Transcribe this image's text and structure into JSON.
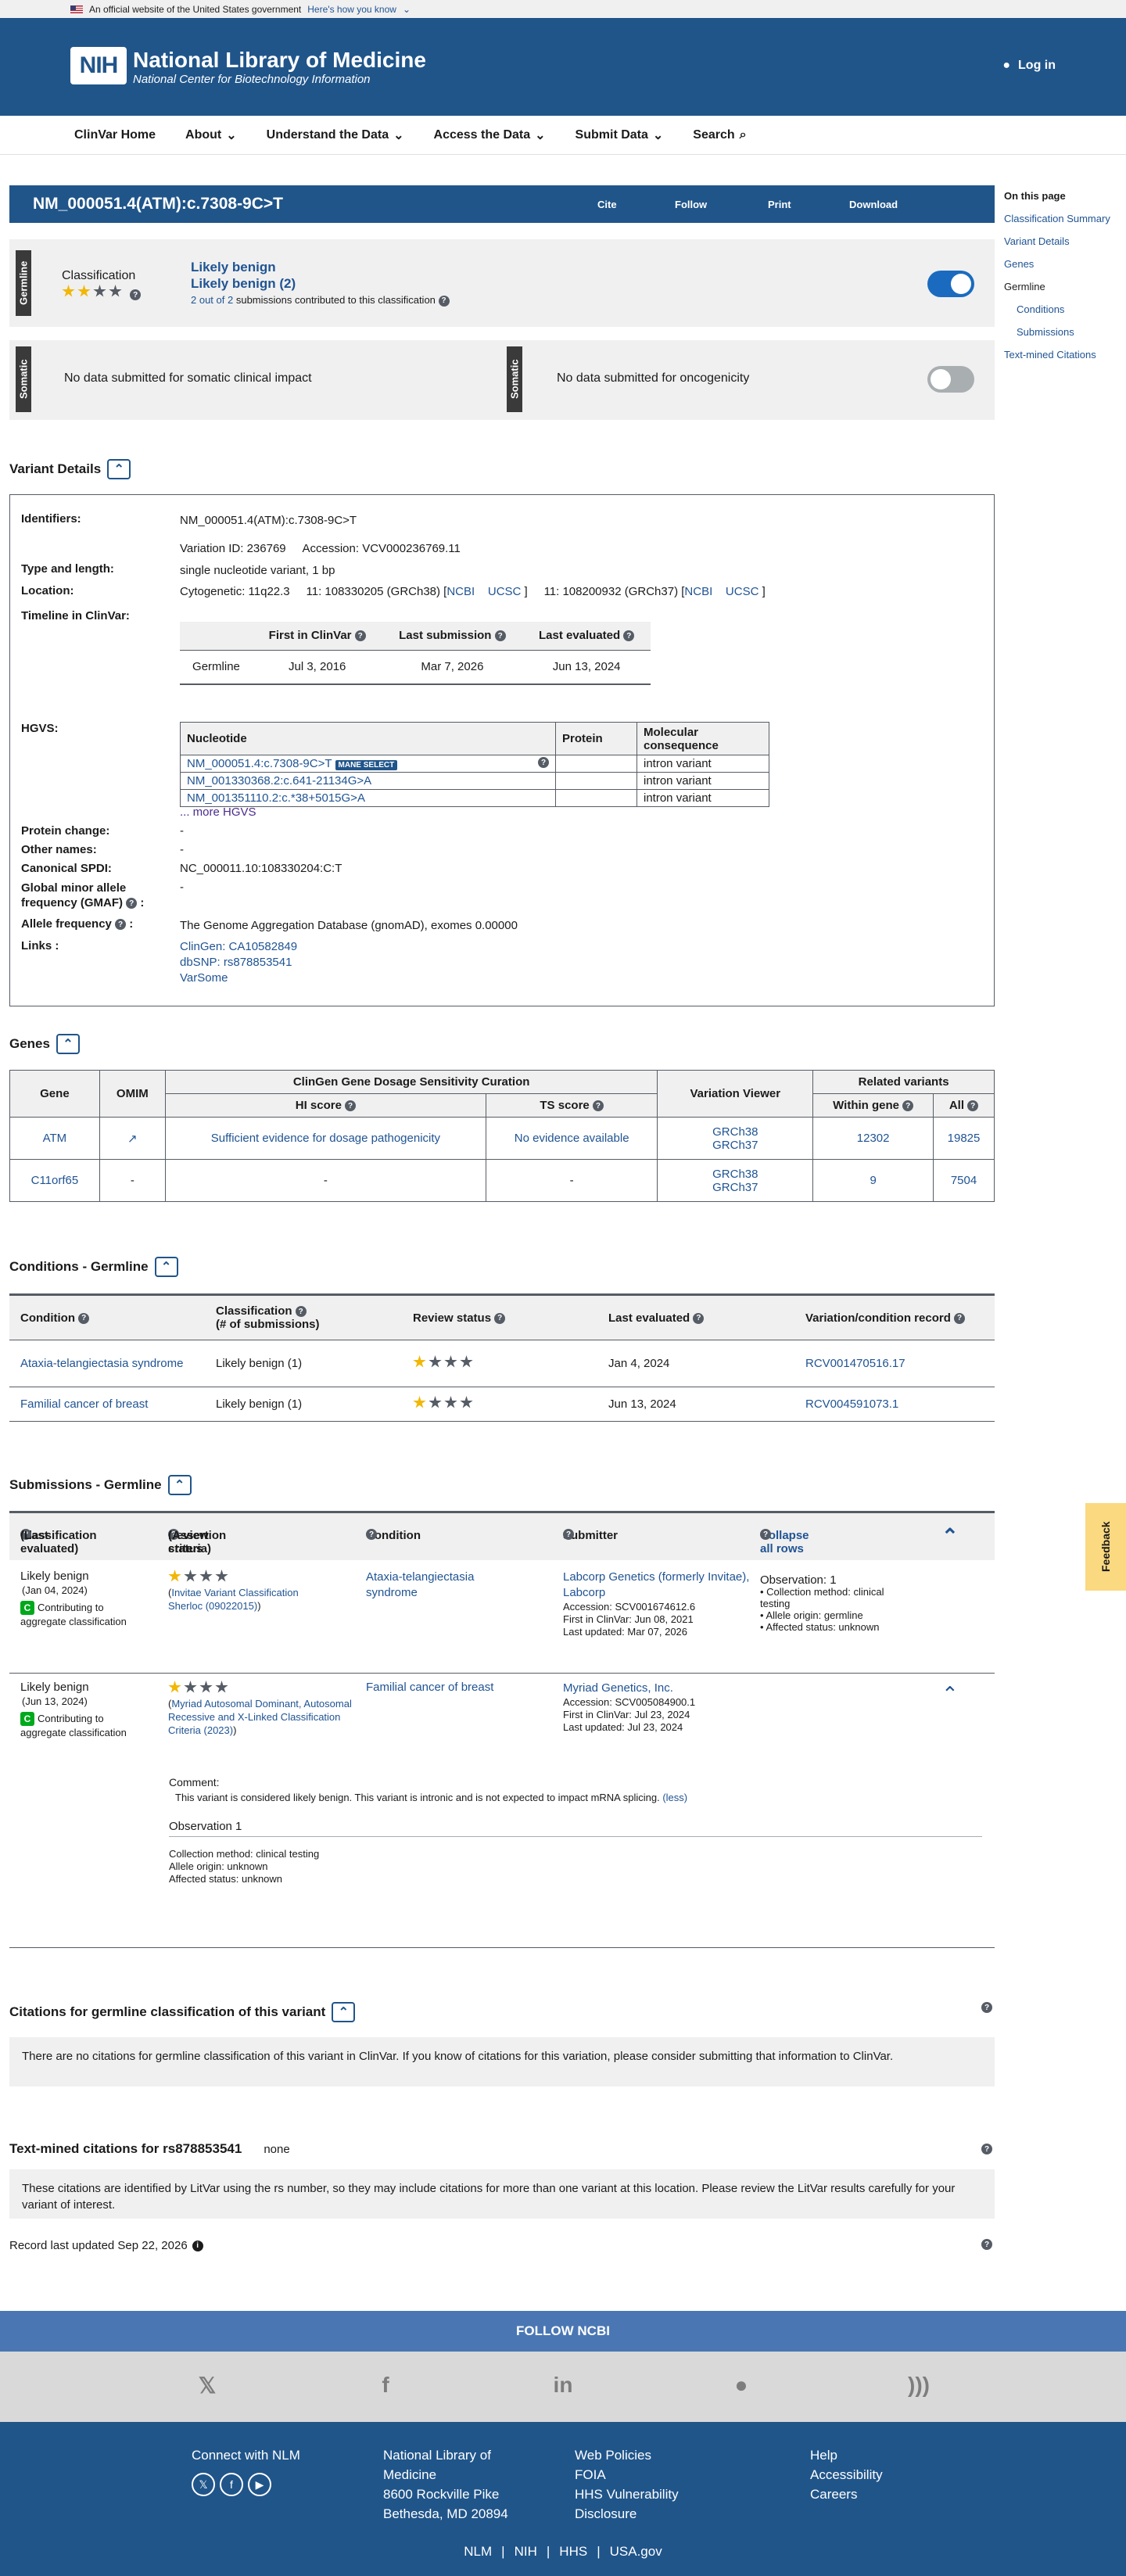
{
  "gov_banner": {
    "text": "An official website of the United States government",
    "link": "Here's how you know"
  },
  "header": {
    "logo": "NIH",
    "title": "National Library of Medicine",
    "subtitle": "National Center for Biotechnology Information",
    "login": "Log in"
  },
  "nav": [
    "ClinVar Home",
    "About",
    "Understand the Data",
    "Access the Data",
    "Submit Data",
    "Search"
  ],
  "titlebar": {
    "title": "NM_000051.4(ATM):c.7308-9C>T",
    "cite": "Cite",
    "follow": "Follow",
    "print": "Print",
    "download": "Download"
  },
  "toc": {
    "heading": "On this page",
    "items": [
      "Classification Summary",
      "Variant Details",
      "Genes"
    ],
    "germline": "Germline",
    "sub": [
      "Conditions",
      "Submissions"
    ],
    "textmined": "Text-mined Citations"
  },
  "germline": {
    "tag": "Germline",
    "label": "Classification",
    "class1": "Likely benign",
    "class2": "Likely benign (2)",
    "contrib": "2 out of 2",
    "contrib_rest": "submissions contributed to this classification",
    "stars_filled": 2,
    "stars_total": 4
  },
  "somatic": {
    "tag": "Somatic",
    "text1": "No data submitted for somatic clinical impact",
    "text2": "No data submitted for oncogenicity"
  },
  "variant_details": {
    "heading": "Variant Details",
    "identifiers_label": "Identifiers:",
    "identifier": "NM_000051.4(ATM):c.7308-9C>T",
    "variation_id": "Variation ID: 236769",
    "accession": "Accession: VCV000236769.11",
    "type_label": "Type and length:",
    "type": "single nucleotide variant, 1 bp",
    "location_label": "Location:",
    "cyto": "Cytogenetic: 11q22.3",
    "loc38": "11: 108330205 (GRCh38) [",
    "loc37": "11: 108200932 (GRCh37) [",
    "ncbi": "NCBI",
    "ucsc": "UCSC",
    "timeline_label": "Timeline in ClinVar:",
    "tl_first": "First in ClinVar",
    "tl_last": "Last submission",
    "tl_eval": "Last evaluated",
    "tl_row": "Germline",
    "tl_first_v": "Jul 3, 2016",
    "tl_last_v": "Mar 7, 2026",
    "tl_eval_v": "Jun 13, 2024",
    "hgvs_label": "HGVS:",
    "hgvs_cols": [
      "Nucleotide",
      "Protein",
      "Molecular consequence"
    ],
    "hgvs_rows": [
      {
        "nuc": "NM_000051.4:c.7308-9C>T",
        "protein": "",
        "cons": "intron variant"
      },
      {
        "nuc": "NM_001330368.2:c.641-21134G>A",
        "protein": "",
        "cons": "intron variant"
      },
      {
        "nuc": "NM_001351110.2:c.*38+5015G>A",
        "protein": "",
        "cons": "intron variant"
      }
    ],
    "mane": "MANE SELECT",
    "more_hgvs": "... more HGVS",
    "protein_label": "Protein change:",
    "protein": "-",
    "other_label": "Other names:",
    "other": "-",
    "spdi_label": "Canonical SPDI:",
    "spdi": "NC_000011.10:108330204:C:T",
    "gmaf_label": "Global minor allele frequency (GMAF)",
    "gmaf": "-",
    "af_label": "Allele frequency",
    "af": "The Genome Aggregation Database (gnomAD), exomes 0.00000",
    "links_label": "Links :",
    "links": [
      "ClinGen: CA10582849",
      "dbSNP: rs878853541",
      "VarSome"
    ]
  },
  "genes": {
    "heading": "Genes",
    "cols": {
      "gene": "Gene",
      "omim": "OMIM",
      "clingen": "ClinGen Gene Dosage Sensitivity Curation",
      "hi": "HI score",
      "ts": "TS score",
      "viewer": "Variation Viewer",
      "related": "Related variants",
      "within": "Within gene",
      "all": "All"
    },
    "rows": [
      {
        "gene": "ATM",
        "omim": "↗",
        "hi": "Sufficient evidence for dosage pathogenicity",
        "ts": "No evidence available",
        "v1": "GRCh38",
        "v2": "GRCh37",
        "within": "12302",
        "all": "19825"
      },
      {
        "gene": "C11orf65",
        "omim": "-",
        "hi": "-",
        "ts": "-",
        "v1": "GRCh38",
        "v2": "GRCh37",
        "within": "9",
        "all": "7504"
      }
    ]
  },
  "conditions": {
    "heading": "Conditions - Germline",
    "cols": [
      "Condition",
      "Classification",
      "(# of submissions)",
      "Review status",
      "Last evaluated",
      "Variation/condition record"
    ],
    "rows": [
      {
        "cond": "Ataxia-telangiectasia syndrome",
        "class": "Likely benign (1)",
        "eval": "Jan 4, 2024",
        "rcv": "RCV001470516.17"
      },
      {
        "cond": "Familial cancer of breast",
        "class": "Likely benign (1)",
        "eval": "Jun 13, 2024",
        "rcv": "RCV004591073.1"
      }
    ]
  },
  "submissions": {
    "heading": "Submissions - Germline",
    "cols": {
      "class": "Classification",
      "class2": "(Last evaluated)",
      "review": "Review status",
      "review2": "(Assertion criteria)",
      "cond": "Condition",
      "submitter": "Submitter",
      "collapse": "Collapse all rows"
    },
    "rows": [
      {
        "class": "Likely benign",
        "date": "(Jan 04, 2024)",
        "contrib": "Contributing to aggregate classification",
        "criteria": "Invitae Variant Classification Sherloc (09022015)",
        "cond": "Ataxia-telangiectasia syndrome",
        "submitter": "Labcorp Genetics (formerly Invitae), Labcorp",
        "acc": "Accession: SCV001674612.6",
        "first": "First in ClinVar: Jun 08, 2021",
        "updated": "Last updated: Mar 07, 2026",
        "obs": "Observation: 1",
        "obs_items": [
          "Collection method: clinical testing",
          "Allele origin: germline",
          "Affected status: unknown"
        ]
      },
      {
        "class": "Likely benign",
        "date": "(Jun 13, 2024)",
        "contrib": "Contributing to aggregate classification",
        "criteria": "Myriad Autosomal Dominant, Autosomal Recessive and X-Linked Classification Criteria (2023)",
        "cond": "Familial cancer of breast",
        "submitter": "Myriad Genetics, Inc.",
        "acc": "Accession: SCV005084900.1",
        "first": "First in ClinVar: Jul 23, 2024",
        "updated": "Last updated: Jul 23, 2024"
      }
    ],
    "comment_label": "Comment:",
    "comment": "This variant is considered likely benign. This variant is intronic and is not expected to impact mRNA splicing.",
    "less": "(less)",
    "obs_heading": "Observation 1",
    "obs_lines": [
      "Collection method: clinical testing",
      "Allele origin: unknown",
      "Affected status: unknown"
    ]
  },
  "citations": {
    "heading": "Citations for germline classification of this variant",
    "text": "There are no citations for germline classification of this variant in ClinVar. If you know of citations for this variation, please consider submitting that information to ClinVar."
  },
  "textmined": {
    "heading": "Text-mined citations for rs878853541",
    "none": "none",
    "text": "These citations are identified by LitVar using the rs number, so they may include citations for more than one variant at this location. Please review the LitVar results carefully for your variant of interest."
  },
  "record_updated": "Record last updated Sep 22, 2026",
  "feedback": "Feedback",
  "footer": {
    "follow": "FOLLOW NCBI",
    "connect": "Connect with NLM",
    "addr": [
      "National Library of",
      "Medicine",
      "8600 Rockville Pike",
      "Bethesda, MD 20894"
    ],
    "policies": [
      "Web Policies",
      "FOIA",
      "HHS Vulnerability",
      "Disclosure"
    ],
    "help": [
      "Help",
      "Accessibility",
      "Careers"
    ],
    "bottom": [
      "NLM",
      "NIH",
      "HHS",
      "USA.gov"
    ]
  }
}
